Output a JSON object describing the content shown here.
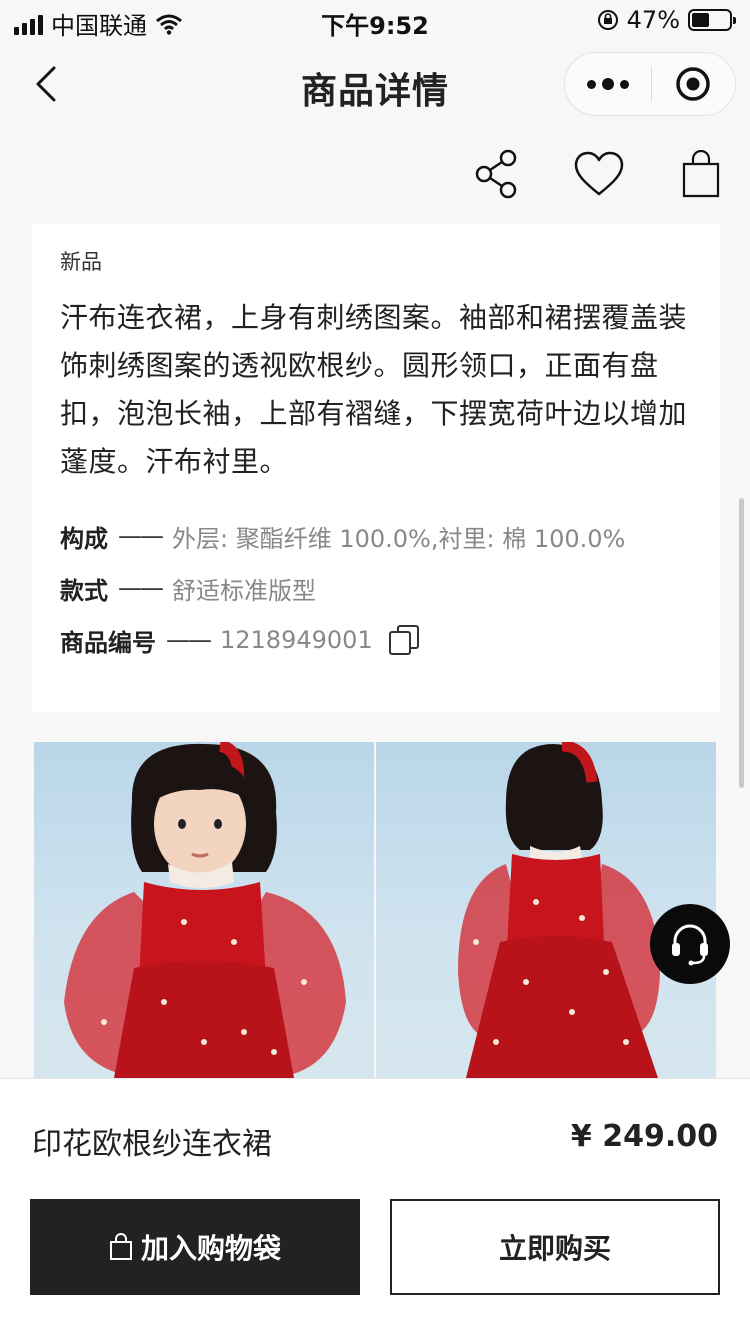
{
  "status_bar": {
    "carrier": "中国联通",
    "time": "下午9:52",
    "battery": "47%",
    "battery_level": 0.47
  },
  "nav": {
    "title": "商品详情"
  },
  "product": {
    "tag": "新品",
    "description": "汗布连衣裙，上身有刺绣图案。袖部和裙摆覆盖装饰刺绣图案的透视欧根纱。圆形领口，正面有盘扣，泡泡长袖，上部有褶缝，下摆宽荷叶边以增加蓬度。汗布衬里。",
    "specs": [
      {
        "key": "构成",
        "dash": "——",
        "value": "外层: 聚酯纤维 100.0%,衬里: 棉 100.0%"
      },
      {
        "key": "款式",
        "dash": "——",
        "value": "舒适标准版型"
      },
      {
        "key": "商品编号",
        "dash": "——",
        "value": "1218949001"
      }
    ]
  },
  "footer": {
    "name": "印花欧根纱连衣裙",
    "price": "¥ 249.00",
    "add_to_bag": "加入购物袋",
    "buy_now": "立即购买"
  },
  "colors": {
    "dark": "#222222",
    "dress_red": "#c8141c",
    "sky": "#c6deec"
  }
}
